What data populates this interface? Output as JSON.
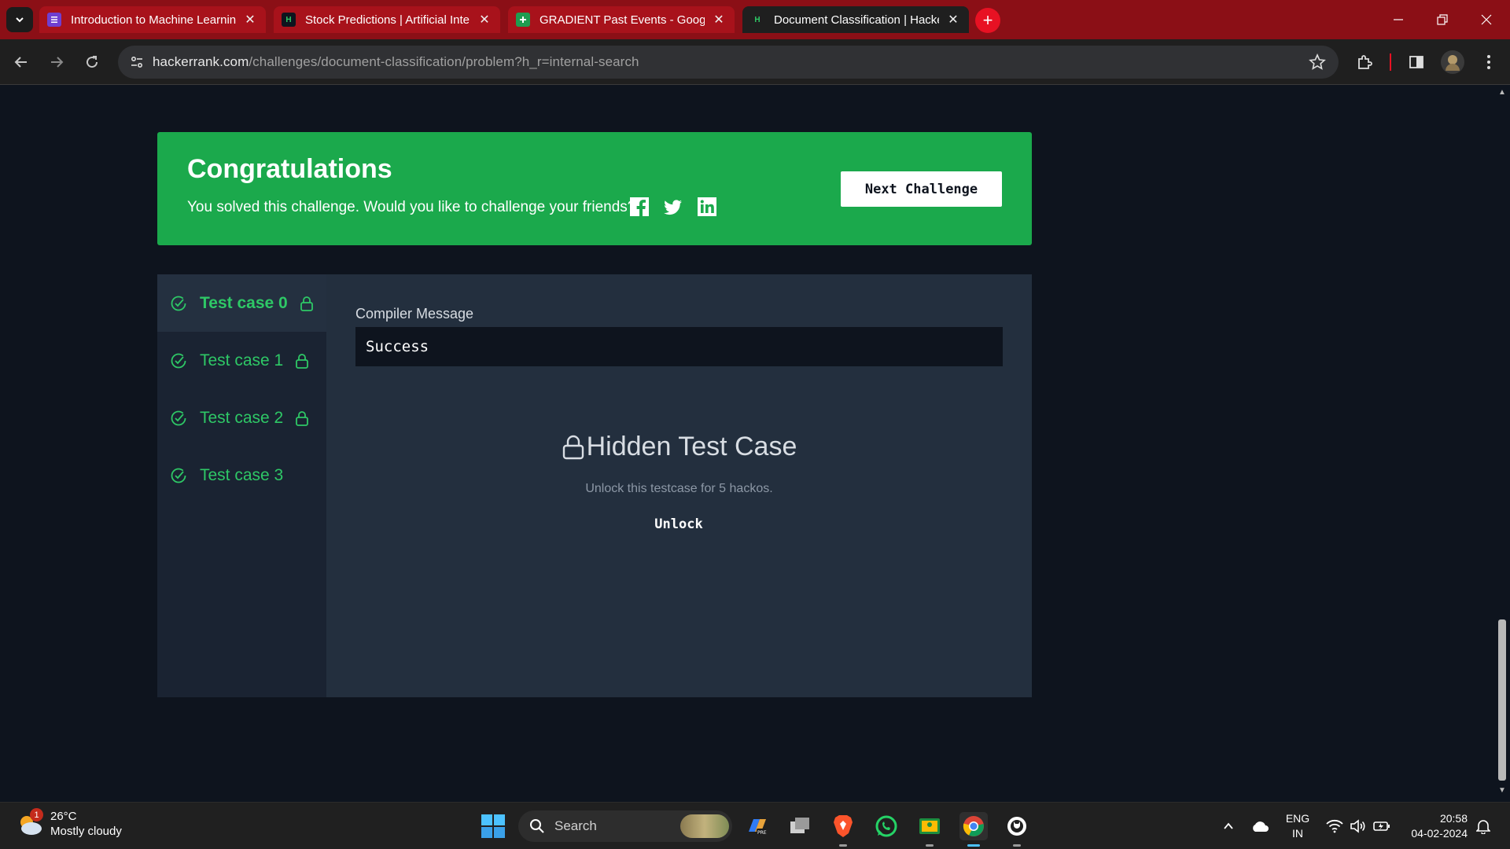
{
  "browser": {
    "tabs": [
      {
        "title": "Introduction to Machine Learning",
        "favicon": "forms-icon",
        "active": false
      },
      {
        "title": "Stock Predictions | Artificial Intelligence",
        "favicon": "hackerrank-icon",
        "active": false
      },
      {
        "title": "GRADIENT Past Events - Google Sheets",
        "favicon": "sheets-icon",
        "active": false
      },
      {
        "title": "Document Classification | HackerRank",
        "favicon": "hackerrank-icon",
        "active": true
      }
    ],
    "new_tab": "+",
    "url_domain": "hackerrank.com",
    "url_path": "/challenges/document-classification/problem?h_r=internal-search"
  },
  "banner": {
    "title": "Congratulations",
    "subtitle": "You solved this challenge. Would you like to challenge your friends?",
    "next_button": "Next Challenge",
    "color": "#1ba94c"
  },
  "test_cases": [
    {
      "label": "Test case 0",
      "locked": true,
      "passed": true,
      "selected": true
    },
    {
      "label": "Test case 1",
      "locked": true,
      "passed": true,
      "selected": false
    },
    {
      "label": "Test case 2",
      "locked": true,
      "passed": true,
      "selected": false
    },
    {
      "label": "Test case 3",
      "locked": false,
      "passed": true,
      "selected": false
    }
  ],
  "detail": {
    "compiler_label": "Compiler Message",
    "compiler_message": "Success",
    "hidden_title": "Hidden Test Case",
    "hidden_sub": "Unlock this testcase for 5 hackos.",
    "unlock_button": "Unlock"
  },
  "taskbar": {
    "weather_badge": "1",
    "temperature": "26°C",
    "condition": "Mostly cloudy",
    "search_placeholder": "Search",
    "lang_line1": "ENG",
    "lang_line2": "IN",
    "time": "20:58",
    "date": "04-02-2024"
  },
  "colors": {
    "accent_green": "#2ec866",
    "page_bg": "#0e141e",
    "tab_bar": "#8b0f16"
  }
}
